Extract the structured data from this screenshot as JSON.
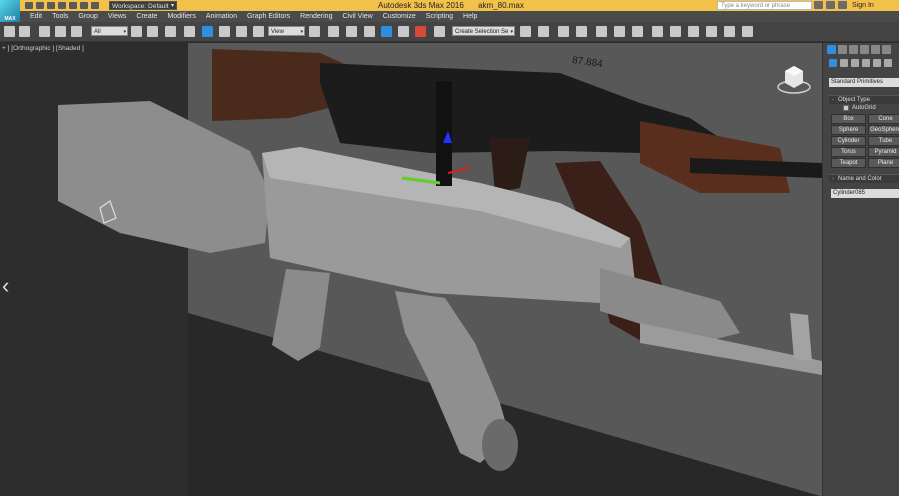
{
  "app": {
    "logo_text": "MAX",
    "workspace": "Workspace: Default",
    "title": "Autodesk 3ds Max 2016",
    "file": "akm_80.max",
    "search_placeholder": "Type a keyword or phrase",
    "sign_in": "Sign In"
  },
  "menu": [
    "Edit",
    "Tools",
    "Group",
    "Views",
    "Create",
    "Modifiers",
    "Animation",
    "Graph Editors",
    "Rendering",
    "Civil View",
    "Customize",
    "Scripting",
    "Help"
  ],
  "toolbar": {
    "selection_filter": "All",
    "ref_coord": "View",
    "named_selection": "Create Selection Se"
  },
  "viewport": {
    "label": "+ ] [Orthographic ] [Shaded ]",
    "measure_label": "87.884",
    "nav_arrow": "‹"
  },
  "command_panel": {
    "category": "Standard Primitives",
    "object_type_title": "Object Type",
    "autogrid_label": "AutoGrid",
    "primitives": [
      "Box",
      "Cone",
      "Sphere",
      "GeoSphere",
      "Cylinder",
      "Tube",
      "Torus",
      "Pyramid",
      "Teapot",
      "Plane"
    ],
    "name_color_title": "Name and Color",
    "object_name": "Cylinder085"
  },
  "colors": {
    "title_bar": "#f2c14a",
    "menu_bg": "#4b4b4b",
    "toolbar_bg": "#444444",
    "viewport_bg": "#2d2d2d",
    "accent_blue": "#2e8fe0"
  }
}
